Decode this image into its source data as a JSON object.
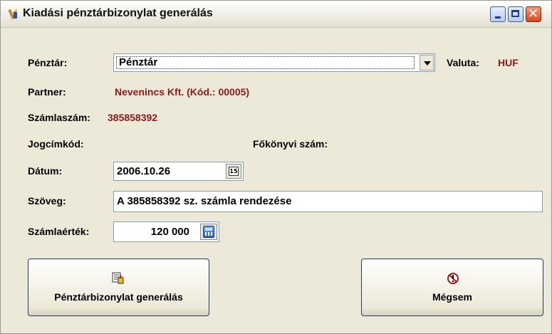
{
  "window": {
    "title": "Kiadási pénztárbizonylat generálás",
    "icon": "app-icon",
    "controls": [
      "minimize-icon",
      "maximize-icon",
      "close-icon"
    ]
  },
  "form": {
    "penztar_label": "Pénztár:",
    "penztar_value": "Pénztár",
    "valuta_label": "Valuta:",
    "valuta_value": "HUF",
    "partner_label": "Partner:",
    "partner_value": "Nevenincs Kft. (Kód.: 00005)",
    "szamlaszam_label": "Számlaszám:",
    "szamlaszam_value": "385858392",
    "jogcimkod_label": "Jogcímkód:",
    "fokonyvi_label": "Főkönyvi szám:",
    "datum_label": "Dátum:",
    "datum_value": "2006.10.26",
    "calendar_icon_text": "15",
    "szoveg_label": "Szöveg:",
    "szoveg_value": "A 385858392 sz. számla rendezése",
    "szamlaertek_label": "Számlaérték:",
    "szamlaertek_value": "120 000"
  },
  "buttons": {
    "generate_label": "Pénztárbizonylat generálás",
    "cancel_label": "Mégsem"
  },
  "colors": {
    "window_bg": "#ece9d8",
    "accent_red": "#8b1a1a",
    "button_border": "#1d3a6b"
  }
}
